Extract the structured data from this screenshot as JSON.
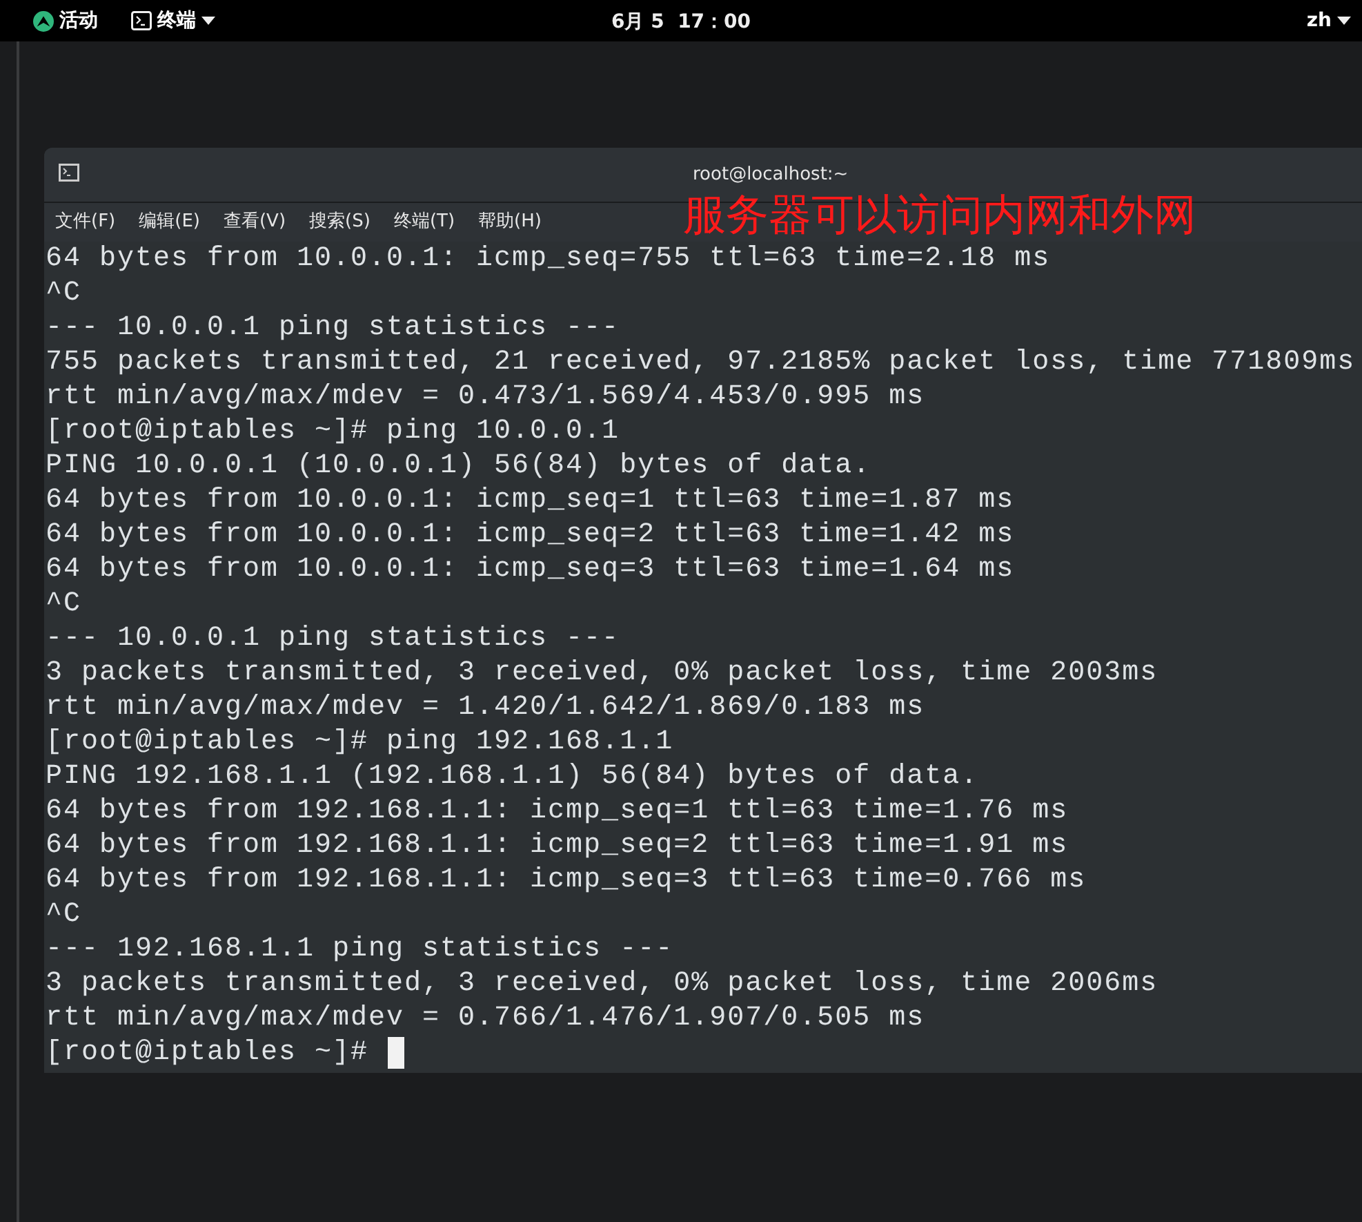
{
  "top_bar": {
    "activities": "活动",
    "app_menu": "终端",
    "clock": "6月 5  17：00",
    "language": "zh"
  },
  "window": {
    "title": "root@localhost:~",
    "menu": [
      "文件(F)",
      "编辑(E)",
      "查看(V)",
      "搜索(S)",
      "终端(T)",
      "帮助(H)"
    ],
    "lines": [
      "64 bytes from 10.0.0.1: icmp_seq=755 ttl=63 time=2.18 ms",
      "^C",
      "--- 10.0.0.1 ping statistics ---",
      "755 packets transmitted, 21 received, 97.2185% packet loss, time 771809ms",
      "rtt min/avg/max/mdev = 0.473/1.569/4.453/0.995 ms",
      "[root@iptables ~]# ping 10.0.0.1",
      "PING 10.0.0.1 (10.0.0.1) 56(84) bytes of data.",
      "64 bytes from 10.0.0.1: icmp_seq=1 ttl=63 time=1.87 ms",
      "64 bytes from 10.0.0.1: icmp_seq=2 ttl=63 time=1.42 ms",
      "64 bytes from 10.0.0.1: icmp_seq=3 ttl=63 time=1.64 ms",
      "^C",
      "--- 10.0.0.1 ping statistics ---",
      "3 packets transmitted, 3 received, 0% packet loss, time 2003ms",
      "rtt min/avg/max/mdev = 1.420/1.642/1.869/0.183 ms",
      "[root@iptables ~]# ping 192.168.1.1",
      "PING 192.168.1.1 (192.168.1.1) 56(84) bytes of data.",
      "64 bytes from 192.168.1.1: icmp_seq=1 ttl=63 time=1.76 ms",
      "64 bytes from 192.168.1.1: icmp_seq=2 ttl=63 time=1.91 ms",
      "64 bytes from 192.168.1.1: icmp_seq=3 ttl=63 time=0.766 ms",
      "^C",
      "--- 192.168.1.1 ping statistics ---",
      "3 packets transmitted, 3 received, 0% packet loss, time 2006ms",
      "rtt min/avg/max/mdev = 0.766/1.476/1.907/0.505 ms"
    ],
    "prompt": "[root@iptables ~]#"
  },
  "annotation": "服务器可以访问内网和外网"
}
